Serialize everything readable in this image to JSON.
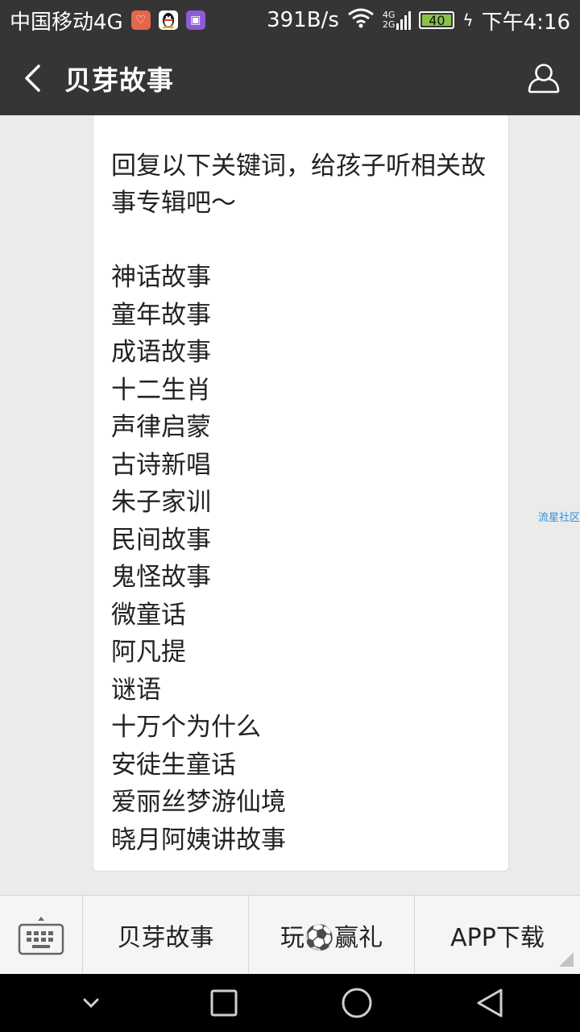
{
  "status_bar": {
    "carrier": "中国移动4G",
    "network_speed": "391B/s",
    "net_top": "4G",
    "net_bottom": "2G",
    "battery": "40",
    "time": "下午4:16"
  },
  "app_bar": {
    "title": "贝芽故事",
    "back_icon": "chevron-left-icon",
    "profile_icon": "person-icon"
  },
  "message": {
    "intro": "回复以下关键词，给孩子听相关故事专辑吧～",
    "keywords": [
      "神话故事",
      "童年故事",
      "成语故事",
      "十二生肖",
      "声律启蒙",
      "古诗新唱",
      "朱子家训",
      "民间故事",
      "鬼怪故事",
      "微童话",
      "阿凡提",
      "谜语",
      "十万个为什么",
      "安徒生童话",
      "爱丽丝梦游仙境",
      "晓月阿姨讲故事"
    ]
  },
  "watermark": "流星社区",
  "bottom_menu": {
    "keyboard_icon": "keyboard-icon",
    "items": [
      {
        "label": "贝芽故事"
      },
      {
        "label": "玩⚽赢礼"
      },
      {
        "label": "APP下载"
      }
    ]
  },
  "colors": {
    "bar_background": "#353535",
    "page_background": "#ebebeb",
    "watermark": "#2a8fd8",
    "battery_fill": "#8bc34a"
  }
}
